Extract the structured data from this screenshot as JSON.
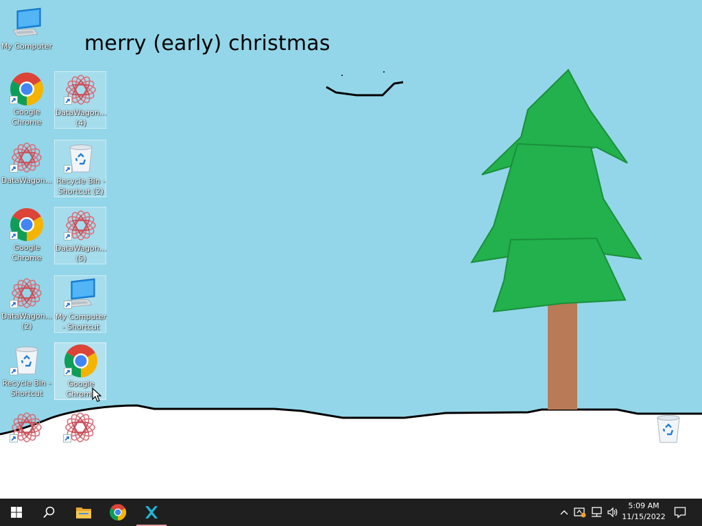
{
  "desktop": {
    "greeting": "merry (early) christmas",
    "sky_color": "#93d6e9",
    "snow_color": "#ffffff",
    "tree_color": "#22b14c",
    "trunk_color": "#b97a57",
    "icons": [
      {
        "label": "My Computer",
        "icon": "computer-icon",
        "shortcut": false
      },
      {
        "label": "Google Chrome",
        "icon": "chrome-icon",
        "shortcut": true
      },
      {
        "label": "DataWagon... (4)",
        "icon": "datawagon-icon",
        "shortcut": true
      },
      {
        "label": "DataWagon...",
        "icon": "datawagon-icon",
        "shortcut": true
      },
      {
        "label": "Recycle Bin - Shortcut (2)",
        "icon": "recycle-bin-icon",
        "shortcut": true
      },
      {
        "label": "Google Chrome",
        "icon": "chrome-icon",
        "shortcut": true
      },
      {
        "label": "DataWagon... (5)",
        "icon": "datawagon-icon",
        "shortcut": true
      },
      {
        "label": "DataWagon... (2)",
        "icon": "datawagon-icon",
        "shortcut": true
      },
      {
        "label": "My Computer - Shortcut",
        "icon": "computer-icon",
        "shortcut": true
      },
      {
        "label": "Recycle Bin - Shortcut",
        "icon": "recycle-bin-icon",
        "shortcut": true
      },
      {
        "label": "Google Chrome",
        "icon": "chrome-icon",
        "shortcut": true
      },
      {
        "label": "",
        "icon": "datawagon-icon",
        "shortcut": true
      },
      {
        "label": "",
        "icon": "datawagon-icon",
        "shortcut": true
      },
      {
        "label": "",
        "icon": "recycle-bin-icon",
        "shortcut": false
      }
    ]
  },
  "taskbar": {
    "pinned": [
      {
        "name": "start-button",
        "icon": "windows-icon"
      },
      {
        "name": "search-button",
        "icon": "search-icon"
      },
      {
        "name": "file-explorer-button",
        "icon": "folder-icon"
      },
      {
        "name": "chrome-taskbar-button",
        "icon": "chrome-icon"
      },
      {
        "name": "x-app-taskbar-button",
        "icon": "x-app-icon"
      }
    ],
    "tray": {
      "icons": [
        "chevron-up-icon",
        "security-icon",
        "network-icon",
        "volume-icon"
      ],
      "time": "5:09 AM",
      "date": "11/15/2022",
      "notification_icon": "notification-icon"
    }
  }
}
